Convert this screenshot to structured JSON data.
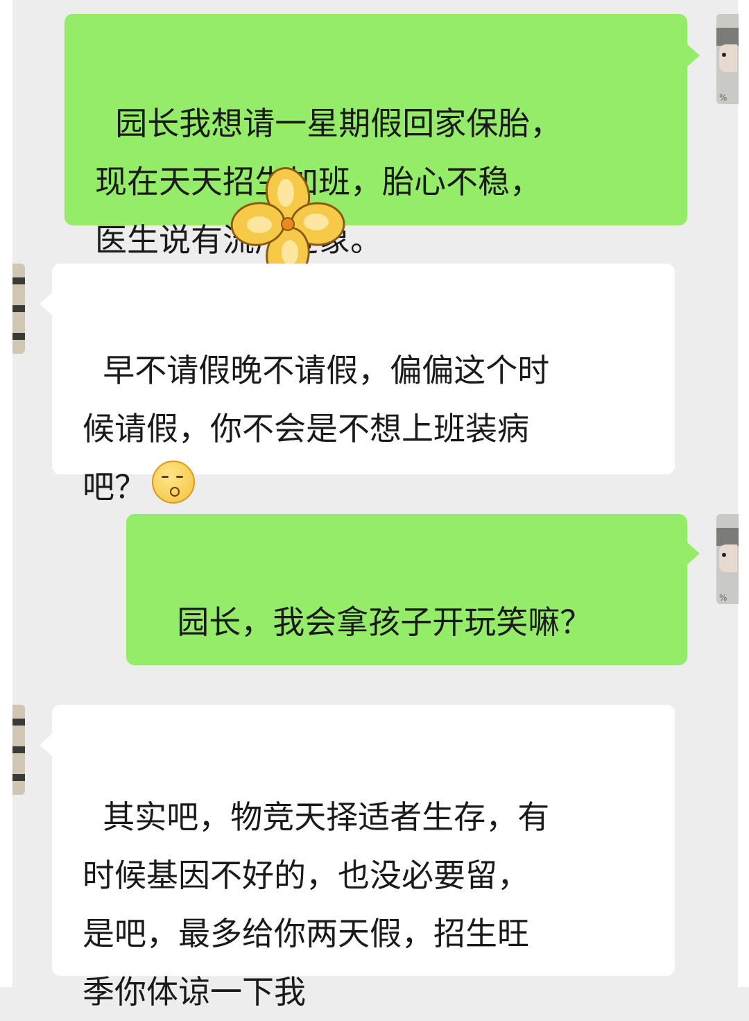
{
  "messages": [
    {
      "from": "me",
      "text": "园长我想请一星期假回家保胎，\n现在天天招生加班，胎心不稳，\n医生说有流产迹象。"
    },
    {
      "from": "principal",
      "text": "早不请假晚不请假，偏偏这个时\n候请假，你不会是不想上班装病\n吧？",
      "emoji": "shushing-face-emoji"
    },
    {
      "from": "me",
      "text": "园长，我会拿孩子开玩笑嘛？"
    },
    {
      "from": "principal",
      "text": "其实吧，物竞天择适者生存，有\n时候基因不好的，也没必要留，\n是吧，最多给你两天假，招生旺\n季你体谅一下我"
    }
  ],
  "sticker": "flower-sticker",
  "colors": {
    "sent_bubble": "#95ec69",
    "received_bubble": "#ffffff",
    "background": "#ededed"
  }
}
